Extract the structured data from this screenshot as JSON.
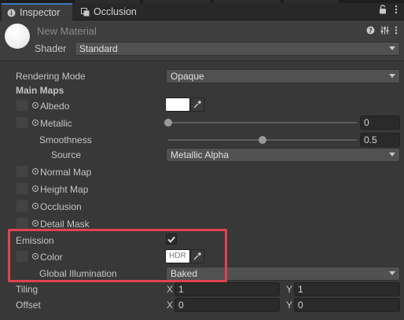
{
  "tabs": [
    {
      "label": "Inspector",
      "icon": "info-icon",
      "active": true
    },
    {
      "label": "Occlusion",
      "icon": "occlusion-icon",
      "active": false
    }
  ],
  "tab_icons": [
    "lock-icon",
    "kebab-menu-icon"
  ],
  "material": {
    "name": "New Material",
    "shader_label": "Shader",
    "shader_value": "Standard",
    "header_icons": [
      "help-icon",
      "preset-icon",
      "kebab-menu-icon"
    ]
  },
  "rendering_mode": {
    "label": "Rendering Mode",
    "value": "Opaque"
  },
  "main_maps": {
    "heading": "Main Maps",
    "albedo": {
      "label": "Albedo",
      "color": "#ffffff"
    },
    "metallic": {
      "label": "Metallic",
      "value": "0",
      "slider_fraction": 0.0
    },
    "smoothness": {
      "label": "Smoothness",
      "value": "0.5",
      "slider_fraction": 0.5
    },
    "source": {
      "label": "Source",
      "value": "Metallic Alpha"
    },
    "normal_map": {
      "label": "Normal Map"
    },
    "height_map": {
      "label": "Height Map"
    },
    "occlusion": {
      "label": "Occlusion"
    },
    "detail_mask": {
      "label": "Detail Mask"
    }
  },
  "emission": {
    "label": "Emission",
    "checked": true,
    "color": {
      "label": "Color",
      "hdr_text": "HDR"
    },
    "global_illumination": {
      "label": "Global Illumination",
      "value": "Baked"
    }
  },
  "tiling": {
    "label": "Tiling",
    "x_label": "X",
    "x_value": "1",
    "y_label": "Y",
    "y_value": "1"
  },
  "offset": {
    "label": "Offset",
    "x_label": "X",
    "x_value": "0",
    "y_label": "Y",
    "y_value": "0"
  },
  "colors": {
    "highlight": "#e0424e",
    "active_tab_accent": "#3a79bb"
  }
}
